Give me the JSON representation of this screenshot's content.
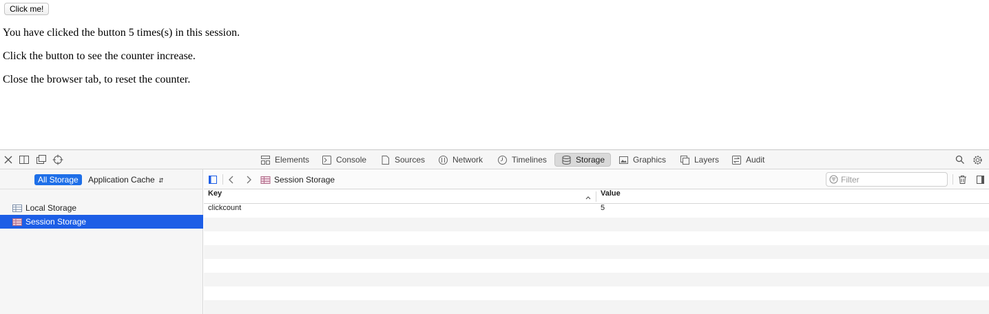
{
  "page": {
    "button_label": "Click me!",
    "lines": [
      "You have clicked the button 5 times(s) in this session.",
      "Click the button to see the counter increase.",
      "Close the browser tab, to reset the counter."
    ]
  },
  "devtools": {
    "tabs": [
      {
        "label": "Elements",
        "icon": "elements-icon"
      },
      {
        "label": "Console",
        "icon": "console-icon"
      },
      {
        "label": "Sources",
        "icon": "sources-icon"
      },
      {
        "label": "Network",
        "icon": "network-icon"
      },
      {
        "label": "Timelines",
        "icon": "timelines-icon"
      },
      {
        "label": "Storage",
        "icon": "storage-icon",
        "active": true
      },
      {
        "label": "Graphics",
        "icon": "graphics-icon"
      },
      {
        "label": "Layers",
        "icon": "layers-icon"
      },
      {
        "label": "Audit",
        "icon": "audit-icon"
      }
    ],
    "sidebar": {
      "scope_all": "All Storage",
      "scope_cache": "Application Cache",
      "items": [
        {
          "label": "Local Storage",
          "selected": false
        },
        {
          "label": "Session Storage",
          "selected": true
        }
      ]
    },
    "content": {
      "breadcrumb": "Session Storage",
      "filter_placeholder": "Filter",
      "columns": {
        "key": "Key",
        "value": "Value"
      },
      "rows": [
        {
          "key": "clickcount",
          "value": "5"
        }
      ]
    },
    "colors": {
      "accent": "#1d5ee6"
    }
  }
}
